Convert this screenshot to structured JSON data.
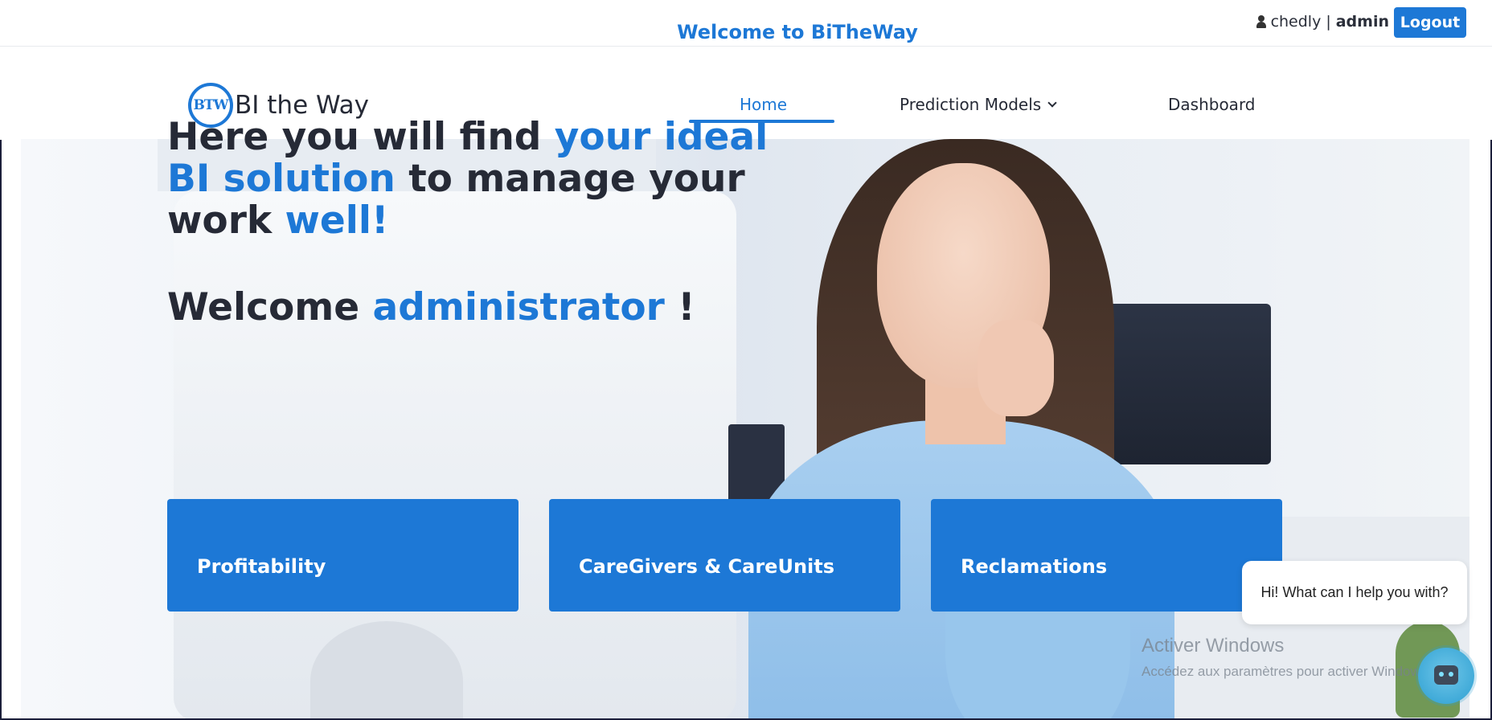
{
  "topbar": {
    "welcome": "Welcome to BiTheWay",
    "username": "chedly",
    "separator": "|",
    "role": "admin",
    "logout_label": "Logout"
  },
  "nav": {
    "logo_mark": "BTW",
    "logo_text": "BI the Way",
    "home": "Home",
    "prediction_models": "Prediction Models",
    "dashboard": "Dashboard"
  },
  "hero": {
    "headline_1": "Here you will find ",
    "headline_2": "your ideal BI solution",
    "headline_3": " to manage your work ",
    "headline_4": "well!",
    "greeting_1": "Welcome ",
    "greeting_2": "administrator",
    "greeting_3": " !"
  },
  "cards": [
    "Profitability",
    "CareGivers & CareUnits",
    "Reclamations"
  ],
  "chat": {
    "message": "Hi! What can I help you with?"
  },
  "watermark": {
    "title": "Activer Windows",
    "subtitle": "Accédez aux paramètres pour activer Windows."
  },
  "colors": {
    "accent": "#1d78d6",
    "text": "#262a36"
  }
}
